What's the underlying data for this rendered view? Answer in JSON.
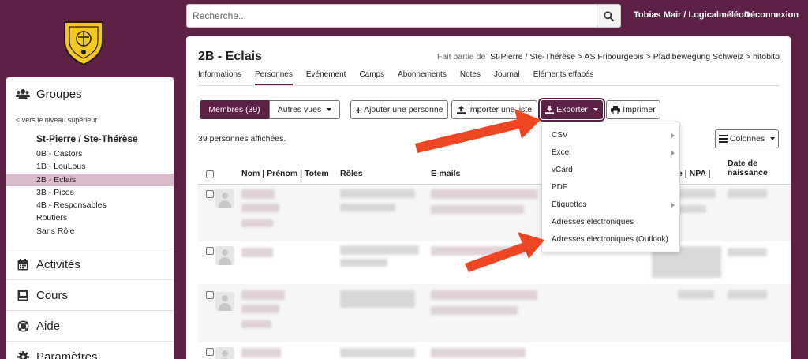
{
  "header": {
    "search_placeholder": "Recherche...",
    "user": "Tobias Mair / Logicalméléon",
    "logout": "Déconnexion"
  },
  "sidebar": {
    "groups_title": "Groupes",
    "back_link": "< vers le niveau supérieur",
    "group_name": "St-Pierre / Ste-Thérèse",
    "items": [
      {
        "label": "0B - Castors"
      },
      {
        "label": "1B - LouLous"
      },
      {
        "label": "2B - Eclais"
      },
      {
        "label": "3B - Picos"
      },
      {
        "label": "4B - Responsables"
      },
      {
        "label": "Routiers"
      },
      {
        "label": "Sans Rôle"
      }
    ],
    "activities": "Activités",
    "courses": "Cours",
    "help": "Aide",
    "settings": "Paramètres"
  },
  "page": {
    "title": "2B - Eclais",
    "breadcrumb_label": "Fait partie de",
    "breadcrumb": [
      "St-Pierre / Ste-Thérèse",
      "AS Fribourgeois",
      "Pfadibewegung Schweiz",
      "hitobito"
    ],
    "tabs": [
      {
        "label": "Informations"
      },
      {
        "label": "Personnes"
      },
      {
        "label": "Événement"
      },
      {
        "label": "Camps"
      },
      {
        "label": "Abonnements"
      },
      {
        "label": "Notes"
      },
      {
        "label": "Journal"
      },
      {
        "label": "Eléments effacés"
      }
    ]
  },
  "toolbar": {
    "members": "Membres (39)",
    "other_views": "Autres vues",
    "add_person": "Ajouter une personne",
    "import_list": "Importer une liste",
    "export": "Exporter",
    "print": "Imprimer",
    "columns": "Colonnes"
  },
  "count_text": "39 personnes affichées.",
  "table": {
    "headers": {
      "name": "Nom | Prénom | Totem",
      "roles": "Rôles",
      "emails": "E-mails",
      "npa": "e | NPA |",
      "birth_1": "Date de",
      "birth_2": "naissance"
    }
  },
  "export_menu": {
    "items": [
      {
        "label": "CSV"
      },
      {
        "label": "Excel"
      },
      {
        "label": "vCard"
      },
      {
        "label": "PDF"
      },
      {
        "label": "Etiquettes"
      },
      {
        "label": "Adresses électroniques"
      },
      {
        "label": "Adresses électroniques (Outlook)"
      }
    ]
  },
  "colors": {
    "brand": "#5c2145",
    "active_nav": "#d8bccb",
    "arrow": "#ee4622"
  }
}
